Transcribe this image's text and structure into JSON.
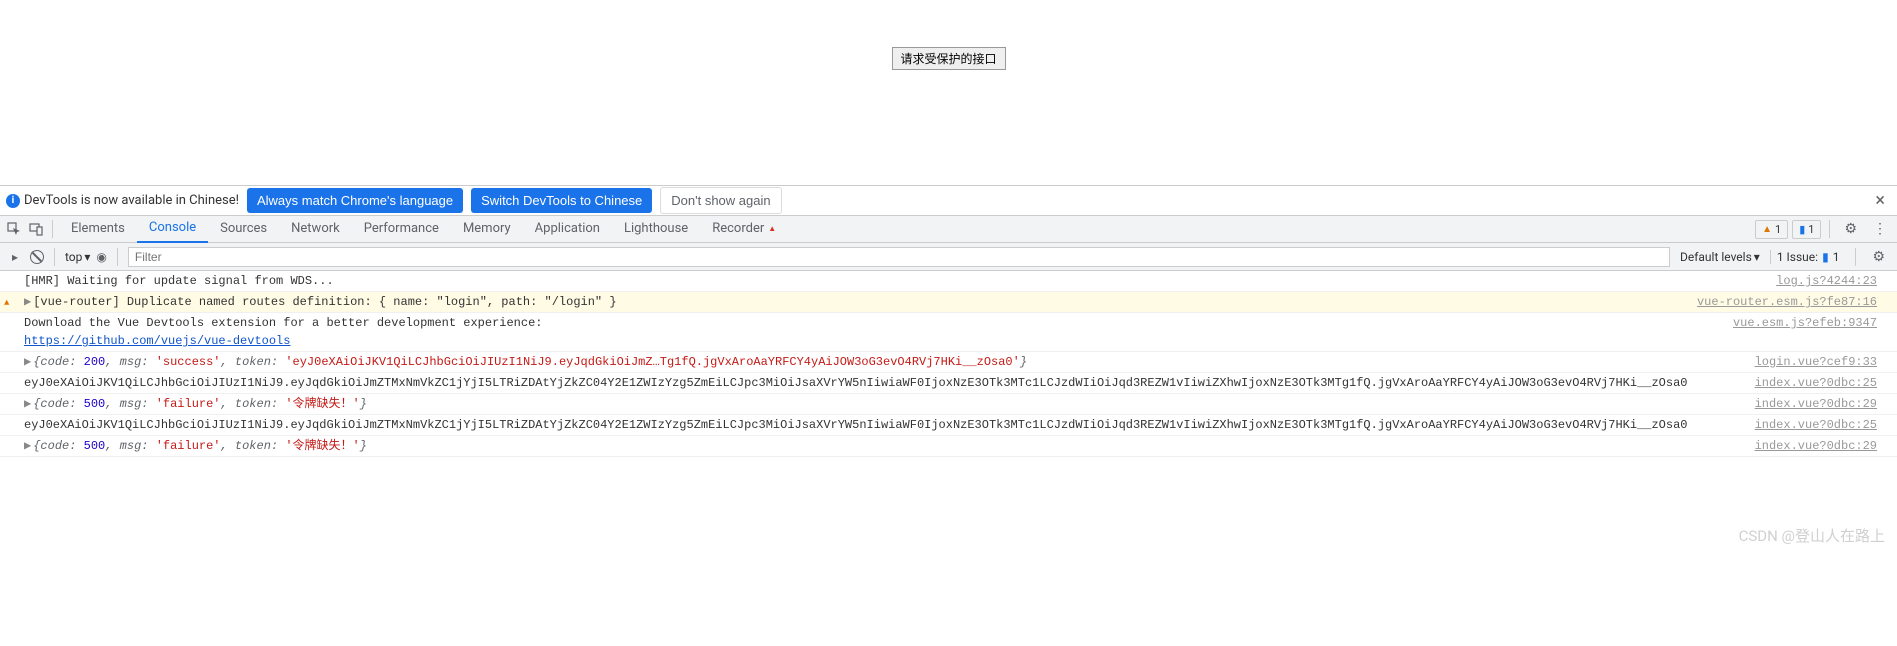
{
  "page": {
    "button_label": "请求受保护的接口"
  },
  "banner": {
    "text": "DevTools is now available in Chinese!",
    "btn_match": "Always match Chrome's language",
    "btn_switch": "Switch DevTools to Chinese",
    "btn_dismiss": "Don't show again",
    "close": "×"
  },
  "tabs": {
    "items": [
      "Elements",
      "Console",
      "Sources",
      "Network",
      "Performance",
      "Memory",
      "Application",
      "Lighthouse",
      "Recorder"
    ],
    "active": "Console",
    "warn_count": "1",
    "info_count": "1"
  },
  "filter": {
    "context": "top",
    "placeholder": "Filter",
    "levels": "Default levels",
    "issue_label": "1 Issue:",
    "issue_count": "1"
  },
  "logs": [
    {
      "type": "log",
      "msg": "[HMR] Waiting for update signal from WDS...",
      "src": "log.js?4244:23"
    },
    {
      "type": "warn",
      "expand": true,
      "msg": "[vue-router] Duplicate named routes definition: { name: \"login\", path: \"/login\" }",
      "src": "vue-router.esm.js?fe87:16"
    },
    {
      "type": "log",
      "msg": "Download the Vue Devtools extension for a better development experience:",
      "link": "https://github.com/vuejs/vue-devtools",
      "src": "vue.esm.js?efeb:9347"
    },
    {
      "type": "obj",
      "expand": true,
      "obj_prefix": "{code: ",
      "code": "200",
      "msg_key": ", msg: ",
      "msg_val": "'success'",
      "tok_key": ", token: ",
      "tok_val": "'eyJ0eXAiOiJKV1QiLCJhbGciOiJIUzI1NiJ9.eyJqdGkiOiJmZ…Tg1fQ.jgVxAroAaYRFCY4yAiJOW3oG3evO4RVj7HKi__zOsa0'",
      "obj_suffix": "}",
      "src": "login.vue?cef9:33"
    },
    {
      "type": "text",
      "msg": "eyJ0eXAiOiJKV1QiLCJhbGciOiJIUzI1NiJ9.eyJqdGkiOiJmZTMxNmVkZC1jYjI5LTRiZDAtYjZkZC04Y2E1ZWIzYzg5ZmEiLCJpc3MiOiJsaXVrYW5nIiwiaWF0IjoxNzE3OTk3MTc1LCJzdWIiOiJqd3REZW1vIiwiZXhwIjoxNzE3OTk3MTg1fQ.jgVxAroAaYRFCY4yAiJOW3oG3evO4RVj7HKi__zOsa0",
      "src": "index.vue?0dbc:25"
    },
    {
      "type": "obj",
      "expand": true,
      "obj_prefix": "{code: ",
      "code": "500",
      "msg_key": ", msg: ",
      "msg_val": "'failure'",
      "tok_key": ", token: ",
      "tok_val": "'令牌缺失！'",
      "obj_suffix": "}",
      "src": "index.vue?0dbc:29"
    },
    {
      "type": "text",
      "msg": "eyJ0eXAiOiJKV1QiLCJhbGciOiJIUzI1NiJ9.eyJqdGkiOiJmZTMxNmVkZC1jYjI5LTRiZDAtYjZkZC04Y2E1ZWIzYzg5ZmEiLCJpc3MiOiJsaXVrYW5nIiwiaWF0IjoxNzE3OTk3MTc1LCJzdWIiOiJqd3REZW1vIiwiZXhwIjoxNzE3OTk3MTg1fQ.jgVxAroAaYRFCY4yAiJOW3oG3evO4RVj7HKi__zOsa0",
      "src": "index.vue?0dbc:25"
    },
    {
      "type": "obj",
      "expand": true,
      "obj_prefix": "{code: ",
      "code": "500",
      "msg_key": ", msg: ",
      "msg_val": "'failure'",
      "tok_key": ", token: ",
      "tok_val": "'令牌缺失！'",
      "obj_suffix": "}",
      "src": "index.vue?0dbc:29"
    }
  ],
  "watermark": "CSDN @登山人在路上"
}
